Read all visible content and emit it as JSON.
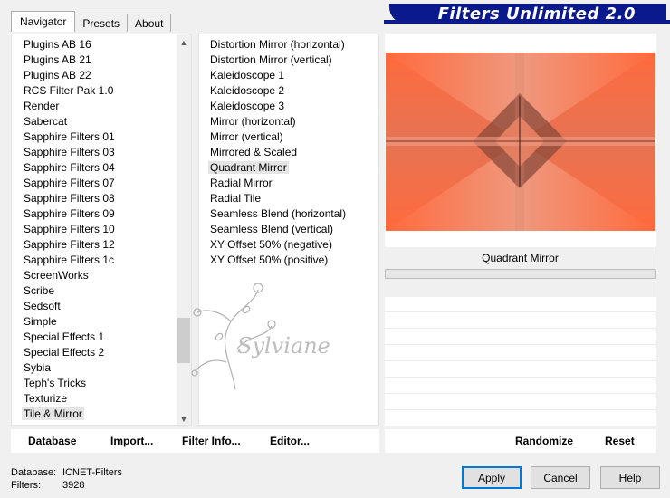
{
  "tabs": [
    {
      "label": "Navigator",
      "active": true
    },
    {
      "label": "Presets",
      "active": false
    },
    {
      "label": "About",
      "active": false
    }
  ],
  "banner": {
    "title": "Filters Unlimited 2.0"
  },
  "categories": {
    "items": [
      "Plugins AB 16",
      "Plugins AB 21",
      "Plugins AB 22",
      "RCS Filter Pak 1.0",
      "Render",
      "Sabercat",
      "Sapphire Filters 01",
      "Sapphire Filters 03",
      "Sapphire Filters 04",
      "Sapphire Filters 07",
      "Sapphire Filters 08",
      "Sapphire Filters 09",
      "Sapphire Filters 10",
      "Sapphire Filters 12",
      "Sapphire Filters 1c",
      "ScreenWorks",
      "Scribe",
      "Sedsoft",
      "Simple",
      "Special Effects 1",
      "Special Effects 2",
      "Sybia",
      "Teph's Tricks",
      "Texturize",
      "Tile & Mirror"
    ],
    "selected": "Tile & Mirror"
  },
  "filters": {
    "items": [
      "Distortion Mirror (horizontal)",
      "Distortion Mirror (vertical)",
      "Kaleidoscope 1",
      "Kaleidoscope 2",
      "Kaleidoscope 3",
      "Mirror (horizontal)",
      "Mirror (vertical)",
      "Mirrored & Scaled",
      "Quadrant Mirror",
      "Radial Mirror",
      "Radial Tile",
      "Seamless Blend (horizontal)",
      "Seamless Blend (vertical)",
      "XY Offset 50% (negative)",
      "XY Offset 50% (positive)"
    ],
    "selected": "Quadrant Mirror"
  },
  "preview": {
    "filter_name": "Quadrant Mirror",
    "accent_color": "#ff6a3d",
    "dark_color": "#7a3324"
  },
  "watermark": {
    "text": "Sylviane"
  },
  "bottom_left": {
    "database": "Database",
    "import": "Import...",
    "filter_info": "Filter Info...",
    "editor": "Editor..."
  },
  "bottom_right": {
    "randomize": "Randomize",
    "reset": "Reset"
  },
  "status": {
    "database_label": "Database:",
    "database_value": "ICNET-Filters",
    "filters_label": "Filters:",
    "filters_value": "3928"
  },
  "buttons": {
    "apply": "Apply",
    "cancel": "Cancel",
    "help": "Help"
  },
  "scrollbar": {
    "up_icon": "chevron-up-icon",
    "down_icon": "chevron-down-icon"
  }
}
